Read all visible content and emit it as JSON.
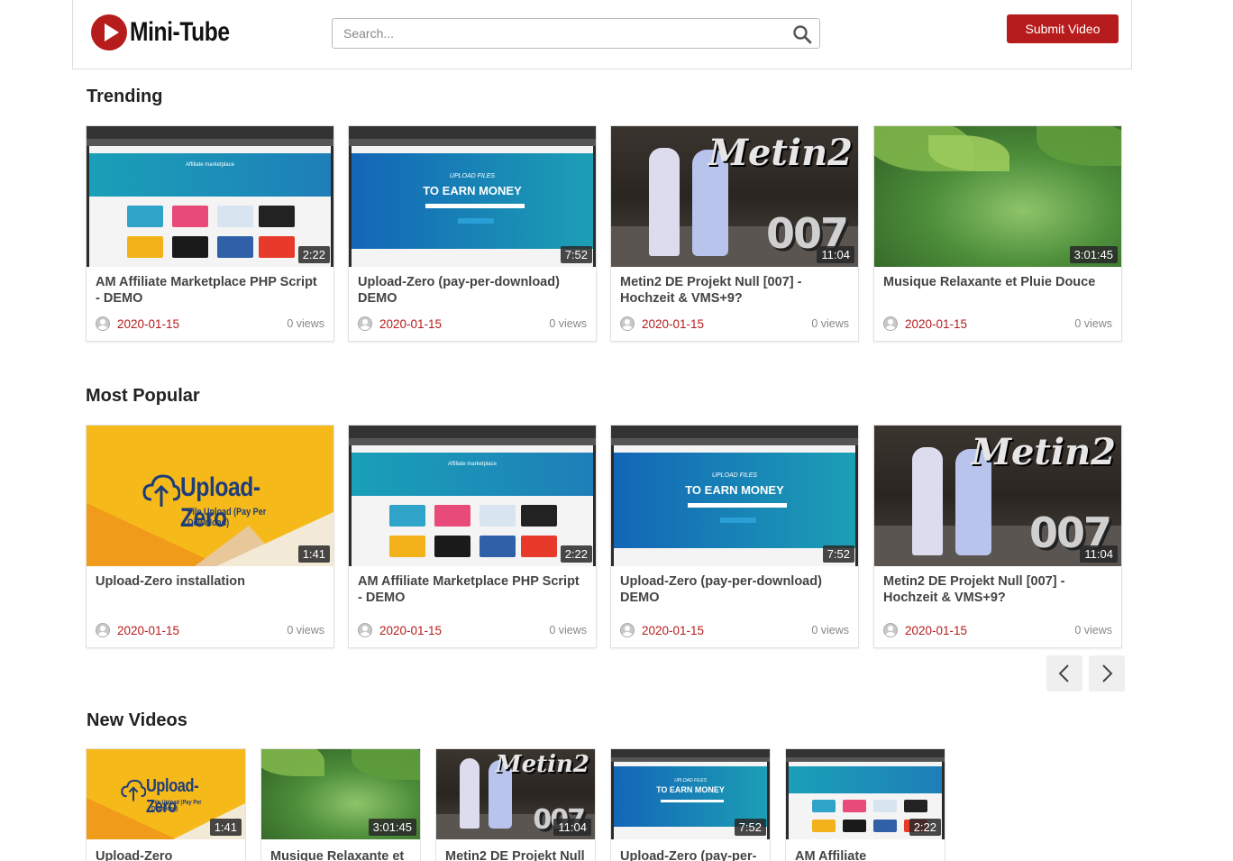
{
  "header": {
    "logo_text": "Mini-Tube",
    "search_placeholder": "Search...",
    "submit_label": "Submit Video"
  },
  "sections": {
    "trending": {
      "title": "Trending",
      "videos": [
        {
          "title": "AM Affiliate Marketplace PHP Script - DEMO",
          "duration": "2:22",
          "date": "2020-01-15",
          "views": "0 views"
        },
        {
          "title": "Upload-Zero (pay-per-download) DEMO",
          "duration": "7:52",
          "date": "2020-01-15",
          "views": "0 views"
        },
        {
          "title": "Metin2 DE Projekt Null [007] - Hochzeit & VMS+9?",
          "duration": "11:04",
          "date": "2020-01-15",
          "views": "0 views"
        },
        {
          "title": "Musique Relaxante et Pluie Douce",
          "duration": "3:01:45",
          "date": "2020-01-15",
          "views": "0 views"
        }
      ]
    },
    "popular": {
      "title": "Most Popular",
      "videos": [
        {
          "title": "Upload-Zero installation",
          "duration": "1:41",
          "date": "2020-01-15",
          "views": "0 views"
        },
        {
          "title": "AM Affiliate Marketplace PHP Script - DEMO",
          "duration": "2:22",
          "date": "2020-01-15",
          "views": "0 views"
        },
        {
          "title": "Upload-Zero (pay-per-download) DEMO",
          "duration": "7:52",
          "date": "2020-01-15",
          "views": "0 views"
        },
        {
          "title": "Metin2 DE Projekt Null [007] - Hochzeit & VMS+9?",
          "duration": "11:04",
          "date": "2020-01-15",
          "views": "0 views"
        }
      ]
    },
    "new_videos": {
      "title": "New Videos",
      "videos": [
        {
          "title": "Upload-Zero",
          "duration": "1:41"
        },
        {
          "title": "Musique Relaxante et",
          "duration": "3:01:45"
        },
        {
          "title": "Metin2 DE Projekt Null",
          "duration": "11:04"
        },
        {
          "title": "Upload-Zero (pay-per-",
          "duration": "7:52"
        },
        {
          "title": "AM Affiliate",
          "duration": "2:22"
        }
      ]
    }
  },
  "thumbnail_text": {
    "affiliate_caption": "Affiliate marketplace",
    "upload_small": "UPLOAD FILES",
    "upload_big": "TO EARN MONEY",
    "metin_title": "Metin2",
    "metin_num": "007",
    "uz_title": "Upload-Zero",
    "uz_sub": "File Upload (Pay Per Download)"
  },
  "colors": {
    "accent": "#b71c1c",
    "date": "#b71c1c"
  },
  "icons": {
    "logo": "play-logo-icon",
    "search": "search-icon",
    "user": "user-avatar-icon",
    "prev": "chevron-left-icon",
    "next": "chevron-right-icon"
  }
}
